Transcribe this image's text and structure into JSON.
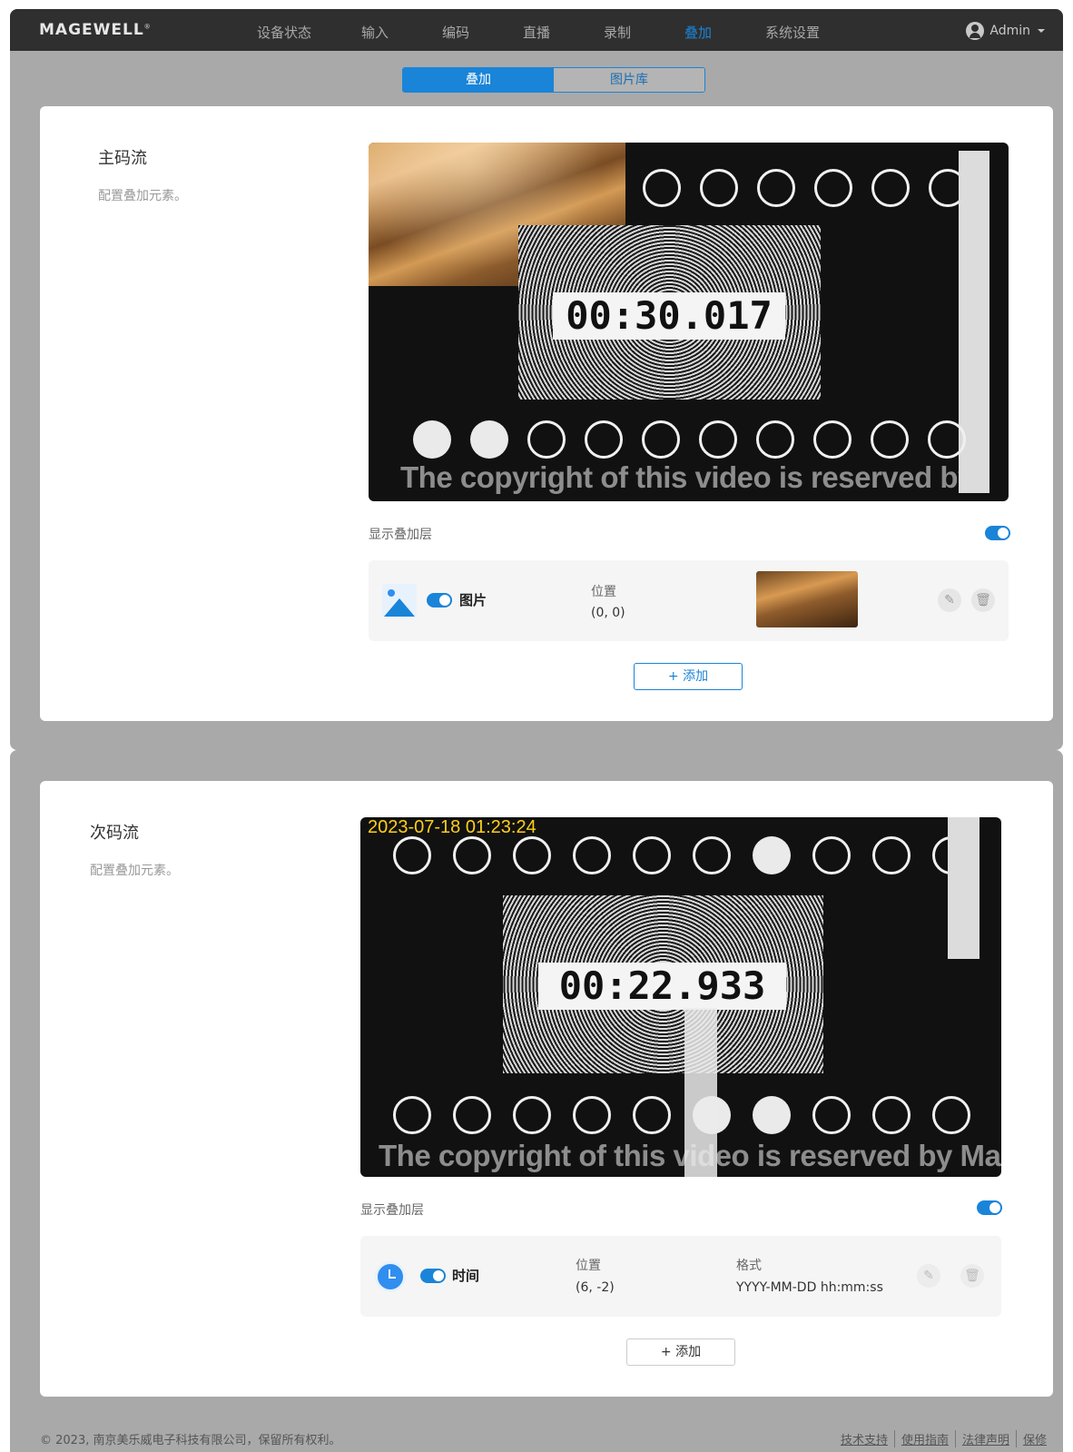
{
  "app": {
    "logo": "MAGEWELL",
    "logo_mark": "®"
  },
  "nav": {
    "items": [
      {
        "label": "设备状态",
        "active": false
      },
      {
        "label": "输入",
        "active": false
      },
      {
        "label": "编码",
        "active": false
      },
      {
        "label": "直播",
        "active": false
      },
      {
        "label": "录制",
        "active": false
      },
      {
        "label": "叠加",
        "active": true
      },
      {
        "label": "系统设置",
        "active": false
      }
    ],
    "user": "Admin"
  },
  "tabs": [
    {
      "label": "叠加",
      "active": true
    },
    {
      "label": "图片库",
      "active": false
    }
  ],
  "main_stream": {
    "title": "主码流",
    "desc": "配置叠加元素。",
    "preview": {
      "timer": "00:30.017",
      "copyright": "The copyright of this video is reserved by Magewell"
    },
    "show_layers_label": "显示叠加层",
    "show_layers_on": true,
    "layer": {
      "icon": "image-icon",
      "enabled": true,
      "name": "图片",
      "position_label": "位置",
      "position_value": "(0, 0)"
    },
    "add_label": "+ 添加"
  },
  "sub_stream": {
    "title": "次码流",
    "desc": "配置叠加元素。",
    "preview": {
      "timestamp": "2023-07-18 01:23:24",
      "timer": "00:22.933",
      "copyright": "The copyright of this video is reserved by Magewell"
    },
    "show_layers_label": "显示叠加层",
    "show_layers_on": true,
    "layer": {
      "icon": "clock-icon",
      "enabled": true,
      "name": "时间",
      "position_label": "位置",
      "position_value": "(6, -2)",
      "format_label": "格式",
      "format_value": "YYYY-MM-DD hh:mm:ss"
    },
    "add_label": "+ 添加"
  },
  "footer": {
    "copyright": "© 2023, 南京美乐威电子科技有限公司，保留所有权利。",
    "links": [
      "技术支持",
      "使用指南",
      "法律声明",
      "保修"
    ]
  },
  "colors": {
    "accent": "#1a84d8",
    "navbar": "#2f2f2f",
    "overlay_gray": "#a9a9a9",
    "timestamp": "#ffcf1a"
  }
}
